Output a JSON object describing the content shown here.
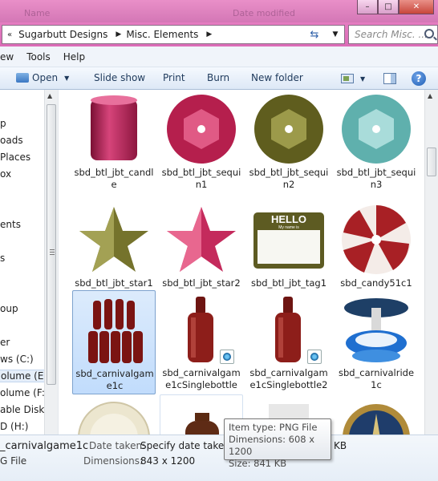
{
  "window": {
    "faded_header_left": "Name",
    "faded_header_mid": "Date modified",
    "minimize": "–",
    "maximize": "□",
    "close": "✕"
  },
  "address": {
    "breadcrumbs": [
      "Sugarbutt Designs",
      "Misc. Elements"
    ],
    "search_placeholder": "Search Misc. ..."
  },
  "menu": [
    "ew",
    "Tools",
    "Help"
  ],
  "toolbar": {
    "open": "Open",
    "slideshow": "Slide show",
    "print": "Print",
    "burn": "Burn",
    "new_folder": "New folder"
  },
  "nav": [
    "p",
    "oads",
    "Places",
    "ox",
    "ents",
    "s",
    "oup",
    "er",
    "ws (C:)",
    "olume (E:)",
    "olume (F:)",
    "able Disk (",
    "D (H:)"
  ],
  "files": [
    {
      "label": "sbd_btl_jbt_candle"
    },
    {
      "label": "sbd_btl_jbt_sequin1"
    },
    {
      "label": "sbd_btl_jbt_sequin2"
    },
    {
      "label": "sbd_btl_jbt_sequin3"
    },
    {
      "label": "sbd_btl_jbt_star1"
    },
    {
      "label": "sbd_btl_jbt_star2"
    },
    {
      "label": "sbd_btl_jbt_tag1",
      "tag_text": "HELLO",
      "tag_sub": "My name is"
    },
    {
      "label": "sbd_candy51c1"
    },
    {
      "label": "sbd_carnivalgame1c"
    },
    {
      "label": "sbd_carnivalgame1cSinglebottle"
    },
    {
      "label": "sbd_carnivalgame1cSinglebottle2"
    },
    {
      "label": "sbd_carnivalride1c"
    }
  ],
  "details": {
    "name": "_carnivalgame1c",
    "type": "G File",
    "date_taken_label": "Date taken:",
    "date_taken_value": "Specify date taken",
    "dimensions_label": "Dimensions:",
    "dimensions_value": "843 x 1200",
    "size_partial": "KB"
  },
  "tooltip": {
    "line1": "Item type: PNG File",
    "line2": "Dimensions: 608 x 1200",
    "line3": "Size: 841 KB"
  },
  "colors": {
    "title_pink": "#e57cc1",
    "selection": "#c1dcfc",
    "sequin1": "#c8285a",
    "sequin2": "#6b6a23",
    "sequin3": "#7fc4c2"
  }
}
